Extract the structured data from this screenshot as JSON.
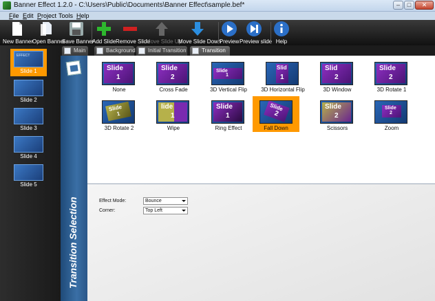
{
  "window": {
    "title": "Banner Effect 1.2.0  -  C:\\Users\\Public\\Documents\\Banner Effect\\sample.bef*",
    "min_label": "–",
    "max_label": "□",
    "close_label": "✕"
  },
  "menu": {
    "file_u": "F",
    "file_rest": "ile",
    "edit_u": "E",
    "edit_rest": "dit",
    "project_u": "P",
    "project_rest": "roject",
    "tools": "Tools",
    "help_u": "H",
    "help_rest": "elp"
  },
  "toolbar": {
    "new_banner": "New Banner",
    "open_banner": "Open Banner",
    "save_banner": "Save Banner",
    "add_slide": "Add Slide",
    "remove_slide": "Remove Slide",
    "move_slide_up": "Move Slide Up",
    "move_slide_down": "Move Slide Down",
    "preview": "Preview",
    "preview_slide": "Preview slide",
    "help": "Help"
  },
  "tabs": {
    "main": "Main",
    "background": "Background",
    "initial_transition": "Initial Transition",
    "transition": "Transition"
  },
  "slides": [
    "Slide 1",
    "Slide 2",
    "Slide 3",
    "Slide 4",
    "Slide 5"
  ],
  "section_title": "Transition Selection",
  "transitions": [
    {
      "label": "None",
      "t": "Slide",
      "n": "1"
    },
    {
      "label": "Cross Fade",
      "t": "Slide",
      "n": "2"
    },
    {
      "label": "3D Vertical Flip",
      "t": "Slide",
      "n": "1"
    },
    {
      "label": "3D Horizontal Flip",
      "t": "Slid",
      "n": "1"
    },
    {
      "label": "3D Window",
      "t": "Slid",
      "n": "2"
    },
    {
      "label": "3D Rotate 1",
      "t": "Slide",
      "n": "2"
    },
    {
      "label": "3D Rotate 2",
      "t": "Slide",
      "n": "1"
    },
    {
      "label": "Wipe",
      "t": "lide",
      "n": "1"
    },
    {
      "label": "Ring Effect",
      "t": "Slide",
      "n": "1"
    },
    {
      "label": "Fall Down",
      "t": "Slide",
      "n": "2"
    },
    {
      "label": "Scissors",
      "t": "Slide",
      "n": "2"
    },
    {
      "label": "Zoom",
      "t": "Slide",
      "n": "2"
    }
  ],
  "options": {
    "effect_mode_label": "Effect Mode:",
    "effect_mode_value": "Bounce",
    "corner_label": "Corner:",
    "corner_value": "Top Left"
  }
}
